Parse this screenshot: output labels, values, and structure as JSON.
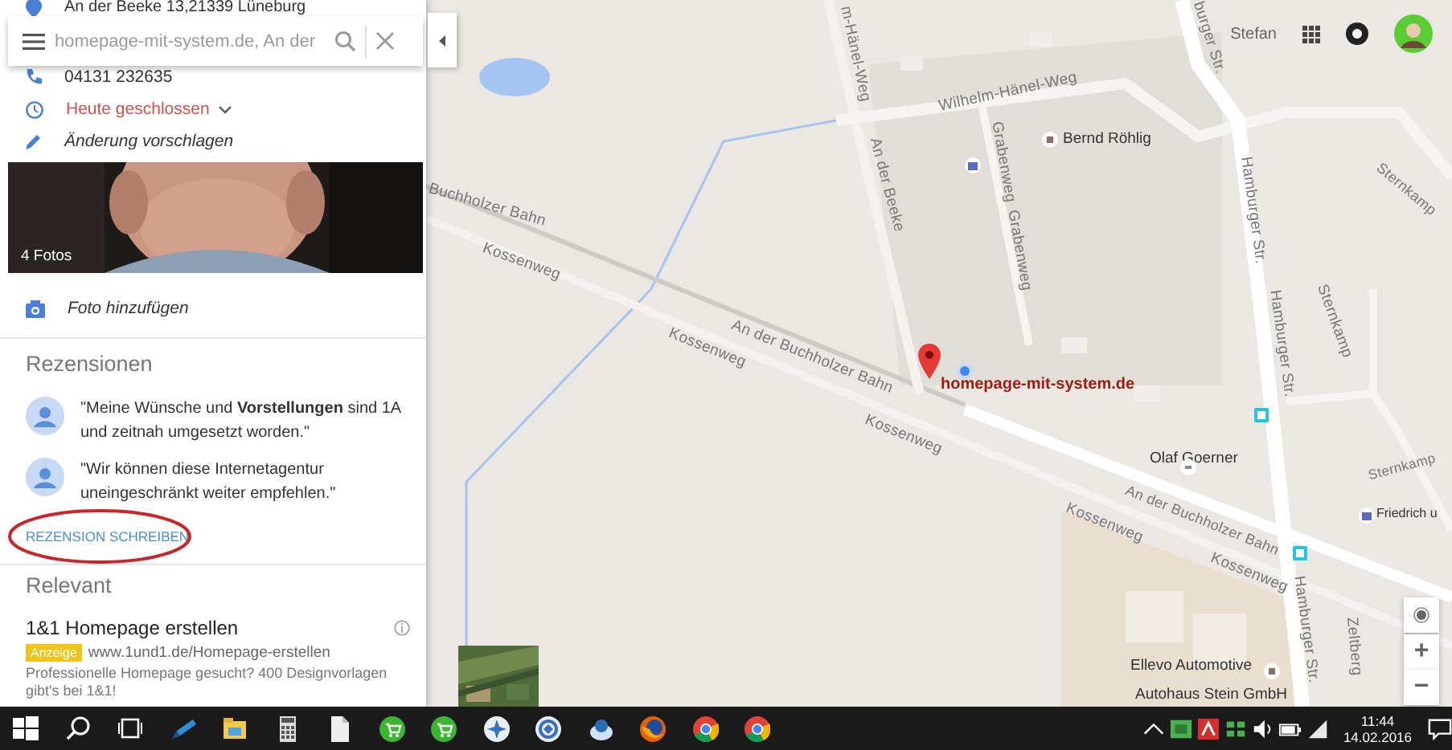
{
  "search": {
    "value": "homepage-mit-system.de, An der"
  },
  "place": {
    "address": "An der Beeke 13,21339 Lüneburg",
    "phone": "04131 232635",
    "hours": "Heute geschlossen",
    "suggest_edit": "Änderung vorschlagen",
    "photos_label": "4 Fotos",
    "add_photo": "Foto hinzufügen"
  },
  "reviews": {
    "title": "Rezensionen",
    "items": [
      {
        "text": "\"Meine Wünsche und **Vorstellungen** sind 1A und zeitnah umgesetzt worden.\""
      },
      {
        "text": "\"Wir können diese Internetagentur uneingeschränkt weiter empfehlen.\""
      }
    ],
    "write_link": "REZENSION SCHREIBEN"
  },
  "relevant": {
    "title": "Relevant",
    "ad": {
      "title": "1&1 Homepage erstellen",
      "badge": "Anzeige",
      "url": "www.1und1.de/Homepage-erstellen",
      "description": "Professionelle Homepage gesucht? 400 Designvorlagen gibt's bei 1&1!"
    }
  },
  "account": {
    "name": "Stefan"
  },
  "map": {
    "labels": [
      {
        "text": "Wilhelm-Hänel-Weg",
        "kind": "street"
      },
      {
        "text": "m-Hänel-Weg",
        "kind": "street"
      },
      {
        "text": "An der Beeke",
        "kind": "street"
      },
      {
        "text": "Grabenweg",
        "kind": "street"
      },
      {
        "text": "Grabenweg",
        "kind": "street"
      },
      {
        "text": "Bernd Röhlig",
        "kind": "place"
      },
      {
        "text": "burger Str.",
        "kind": "street"
      },
      {
        "text": "Hamburger Str.",
        "kind": "street"
      },
      {
        "text": "Hamburger Str.",
        "kind": "street"
      },
      {
        "text": "Sternkamp",
        "kind": "street"
      },
      {
        "text": "Sternkamp",
        "kind": "street"
      },
      {
        "text": "Sternkamp",
        "kind": "street"
      },
      {
        "text": "Buchholzer Bahn",
        "kind": "street"
      },
      {
        "text": "Kossenweg",
        "kind": "street"
      },
      {
        "text": "Kossenweg",
        "kind": "street"
      },
      {
        "text": "An der Buchholzer Bahn",
        "kind": "street"
      },
      {
        "text": "Kossenweg",
        "kind": "street"
      },
      {
        "text": "Kossenweg",
        "kind": "street"
      },
      {
        "text": "An der Buchholzer Bahn",
        "kind": "street"
      },
      {
        "text": "Kossenweg",
        "kind": "street"
      },
      {
        "text": "Hamburger Str.",
        "kind": "street"
      },
      {
        "text": "Zeltberg",
        "kind": "street"
      },
      {
        "text": "Olaf Goerner",
        "kind": "place"
      },
      {
        "text": "Friedrich u",
        "kind": "place"
      },
      {
        "text": "Ellevo Automotive",
        "kind": "place"
      },
      {
        "text": "Autohaus Stein GmbH",
        "kind": "place"
      },
      {
        "text": "homepage-mit-system.de",
        "kind": "marker"
      }
    ],
    "zoom_in": "+",
    "zoom_out": "−"
  },
  "taskbar": {
    "time": "11:44",
    "date": "14.02.2016"
  }
}
